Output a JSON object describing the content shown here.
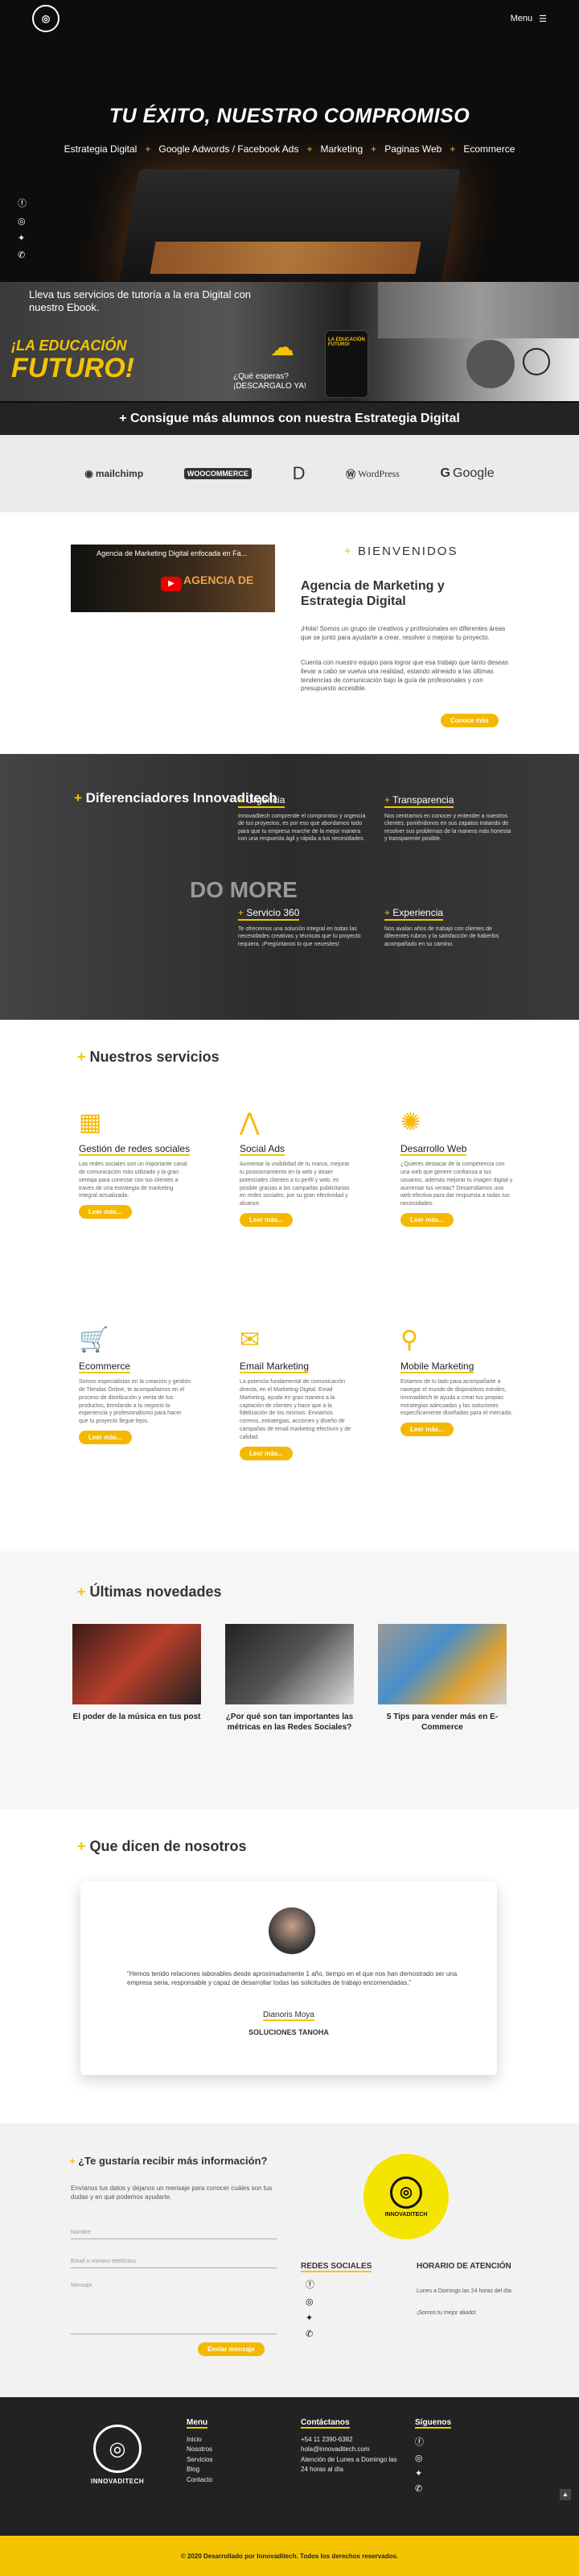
{
  "header": {
    "menu_label": "Menu"
  },
  "hero": {
    "title": "TU ÉXITO, NUESTRO COMPROMISO",
    "links": [
      "Estrategia Digital",
      "Google Adwords / Facebook Ads",
      "Marketing",
      "Paginas Web",
      "Ecommerce"
    ],
    "banner_text": "Lleva tus servicios de tutoría a la era Digital con nuestro Ebook.",
    "banner_edu": "¡LA EDUCACIÓN",
    "banner_futuro": "FUTURO!",
    "banner_question": "¿Qué esperas?",
    "banner_cta": "¡DESCARGALO YA!",
    "banner_phone": "LA EDUCACIÓN FUTURO!",
    "strip": "+ Consigue más alumnos con nuestra Estrategia Digital"
  },
  "partners": [
    "mailchimp",
    "WOOCOMMERCE",
    "D",
    "WordPress",
    "Google"
  ],
  "welcome": {
    "video_title": "Agencia de Marketing Digital enfocada en Fa...",
    "video_overlay": "AGENCIA DE",
    "kicker": "BIENVENIDOS",
    "title": "Agencia de Marketing y Estrategia Digital",
    "p1": "¡Hola! Somos un grupo de creativos y profesionales en diferentes áreas que se juntó para ayudarte a crear, resolver o mejorar tu proyecto.",
    "p2": "Cuenta con nuestro equipo para lograr que esa trabajo que tanto deseas llevar a cabo se vuelva una realidad, estando alineado a las últimas tendencias de comunicación bajo la guía de profesionales y con presupuesto accesible.",
    "button": "Conoce más"
  },
  "diff": {
    "title": "Diferenciadores Innovaditech",
    "domore": "DO MORE",
    "cards": [
      {
        "title": "Urgencia",
        "text": "Innovaditech comprende el compromiso y urgencia de tus proyectos, es por eso que abordamos todo para que tu empresa marche de la mejor manera con una respuesta ágil y rápida a tus necesidades."
      },
      {
        "title": "Transparencia",
        "text": "Nos centramos en conocer y entender a nuestros clientes; poniéndonos en sus zapatos tratando de resolver sus problemas de la manera más honesta y transparente posible."
      },
      {
        "title": "Servicio 360",
        "text": "Te ofrecemos una solución integral en todas las necesidades creativas y técnicas que tu proyecto requiera. ¡Pregúntanos lo que necesites!"
      },
      {
        "title": "Experiencia",
        "text": "Nos avalan años de trabajo con clientes de diferentes rubros y la satisfacción de haberlos acompañado en su camino."
      }
    ]
  },
  "services": {
    "title": "Nuestros servicios",
    "items": [
      {
        "title": "Gestión de redes sociales",
        "icon": "social-media-icon",
        "text": "Las redes sociales son un importante canal de comunicación más utilizado y la gran ventaja para conectar con tus clientes a través de una estrategia de marketing integral actualizada.",
        "button": "Leer más..."
      },
      {
        "title": "Social Ads",
        "icon": "ads-icon",
        "text": "Aumentar la visibilidad de tu marca, mejorar tu posicionamiento en la web y atraer potenciales clientes a tu perfil y web, es posible gracias a las campañas publicitarias en redes sociales, por su gran efectividad y alcance.",
        "button": "Leer más..."
      },
      {
        "title": "Desarrollo Web",
        "icon": "web-dev-icon",
        "text": "¿Quieres destacar de la competencia con una web que genere confianza a tus usuarios, además mejorar tu imagen digital y aumentar tus ventas? Desarrollamos una web efectiva para dar respuesta a todas tus necesidades.",
        "button": "Leer más..."
      },
      {
        "title": "Ecommerce",
        "icon": "cart-icon",
        "text": "Somos especialistas en la creación y gestión de Tiendas Online, te acompañamos en el proceso de distribución y venta de tus productos, brindando a tu negocio la experiencia y profesionalismo para hacer que tu proyecto llegue lejos.",
        "button": "Leer más..."
      },
      {
        "title": "Email Marketing",
        "icon": "email-icon",
        "text": "La potencia fundamental de comunicación directa, en el Marketing Digital. Email Marketing, ayuda en gran manera a la captación de clientes y hace que a la fidelización de los mismos. Enviamos correos, estrategias, acciones y diseño de campañas de email marketing efectivos y de calidad.",
        "button": "Leer más..."
      },
      {
        "title": "Mobile Marketing",
        "icon": "rocket-icon",
        "text": "Estamos de tu lado para acompañarte a navegar el mundo de dispositivos móviles, innovaditech te ayuda a crear tus propias estrategias adecuadas y las soluciones específicamente diseñadas para el mercado.",
        "button": "Leer más..."
      }
    ]
  },
  "news": {
    "title": "Últimas novedades",
    "items": [
      {
        "title": "El poder de la música en tus post"
      },
      {
        "title": "¿Por qué son tan importantes las métricas en las Redes Sociales?"
      },
      {
        "title": "5 Tips para vender más en E-Commerce"
      }
    ]
  },
  "testimonials": {
    "title": "Que dicen de nosotros",
    "quote": "\"Hemos tenido relaciones laborables desde aproximadamente 1 año, tiempo en el que nos han demostrado ser una empresa seria, responsable y capaz de desarrollar todas las solicitudes de trabajo encomendadas.\"",
    "name": "Dianoris Moya",
    "company": "SOLUCIONES TANOHA"
  },
  "contact": {
    "title": "¿Te gustaría recibir más información?",
    "subtitle": "Envíanos tus datos y dejanos un mensaje para conocer cuáles son tus dudas y en qué podemos ayudarte.",
    "fields": {
      "name": "Nombre",
      "email": "Email o número telefónico",
      "message": "Mensaje"
    },
    "button": "Enviar mensaje",
    "logo_name": "INNOVADITECH",
    "redes_title": "REDES SOCIALES",
    "horario_title": "HORARIO DE ATENCIÓN",
    "horario1": "Lunes a Domingo las 24 horas del día",
    "horario2": "¡Somos tu mejor aliado!"
  },
  "footer": {
    "logo_name": "INNOVADITECH",
    "menu_title": "Menu",
    "menu_items": [
      "Inicio",
      "Nosotros",
      "Servicios",
      "Blog",
      "Contacto"
    ],
    "contact_title": "Contáctanos",
    "phone": "+54 11 2390-6382",
    "email": "hola@innovaditech.com",
    "hours": "Atención de Lunes a Domingo las 24 horas al día",
    "follow_title": "Síguenos",
    "copyright": "© 2020 Desarrollado por Innovaditech. Todos los derechos reservados."
  },
  "colors": {
    "accent": "#f5c400",
    "dark": "#222222"
  }
}
